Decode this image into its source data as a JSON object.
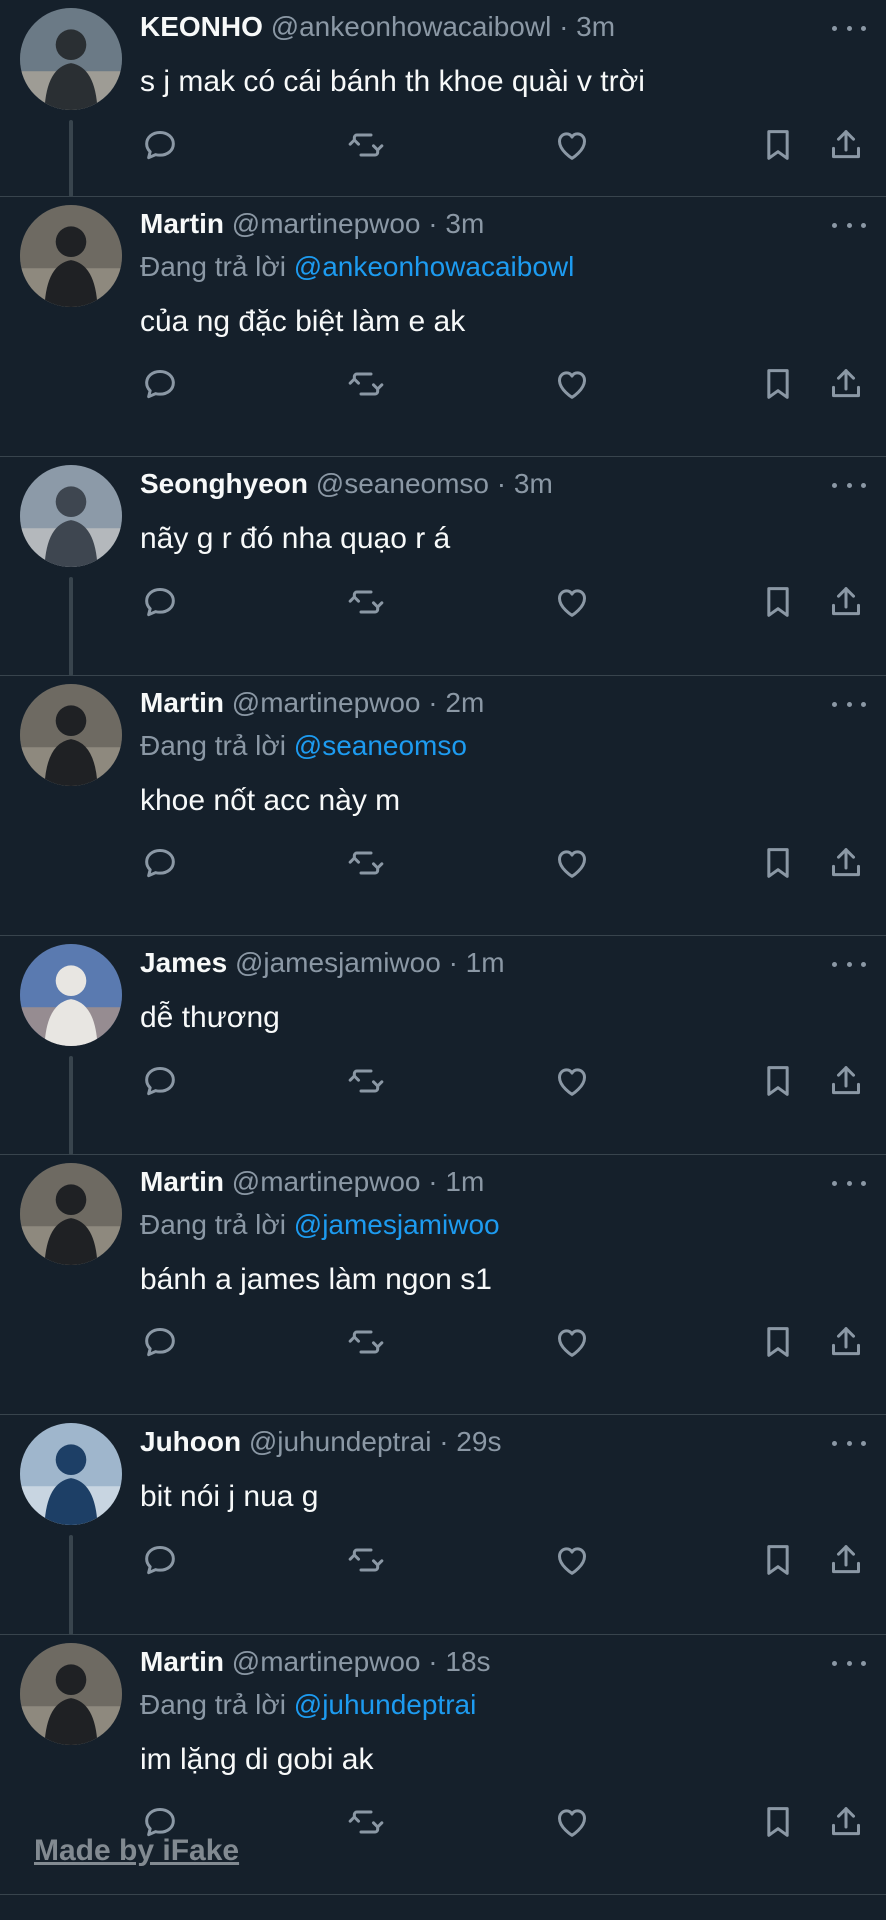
{
  "colors": {
    "background": "#15202b",
    "divider": "#38444d",
    "secondary_text": "#8b98a5",
    "mention": "#1d9bf0"
  },
  "reply_prefix": "Đang trả lời",
  "tweets": [
    {
      "name": "KEONHO",
      "handle": "@ankeonhowacaibowl",
      "time": "· 3m",
      "reply_to": "",
      "text": "s j mak có cái bánh th khoe quài v trời",
      "avatar": "avatar-photo-keonho"
    },
    {
      "name": "Martin",
      "handle": "@martinepwoo",
      "time": "· 3m",
      "reply_to": "@ankeonhowacaibowl",
      "text": "của ng đặc biệt làm e ak",
      "avatar": "avatar-photo-martin"
    },
    {
      "name": "Seonghyeon",
      "handle": "@seaneomso",
      "time": "· 3m",
      "reply_to": "",
      "text": "nãy g r đó nha quạo r á",
      "avatar": "avatar-photo-seonghyeon"
    },
    {
      "name": "Martin",
      "handle": "@martinepwoo",
      "time": "· 2m",
      "reply_to": "@seaneomso",
      "text": "khoe nốt acc này m",
      "avatar": "avatar-photo-martin"
    },
    {
      "name": "James",
      "handle": "@jamesjamiwoo",
      "time": "· 1m",
      "reply_to": "",
      "text": "dễ thương",
      "avatar": "avatar-photo-james"
    },
    {
      "name": "Martin",
      "handle": "@martinepwoo",
      "time": "· 1m",
      "reply_to": "@jamesjamiwoo",
      "text": "bánh a james làm ngon s1",
      "avatar": "avatar-photo-martin"
    },
    {
      "name": "Juhoon",
      "handle": "@juhundeptrai",
      "time": "· 29s",
      "reply_to": "",
      "text": "bit nói j nua g",
      "avatar": "avatar-photo-juhoon"
    },
    {
      "name": "Martin",
      "handle": "@martinepwoo",
      "time": "· 18s",
      "reply_to": "@juhundeptrai",
      "text": "im lặng di gobi ak",
      "avatar": "avatar-photo-martin"
    }
  ],
  "icons": {
    "reply": "reply-icon",
    "retweet": "retweet-icon",
    "like": "heart-icon",
    "bookmark": "bookmark-icon",
    "share": "share-icon",
    "more": "more-icon"
  },
  "watermark": "Made by iFake"
}
